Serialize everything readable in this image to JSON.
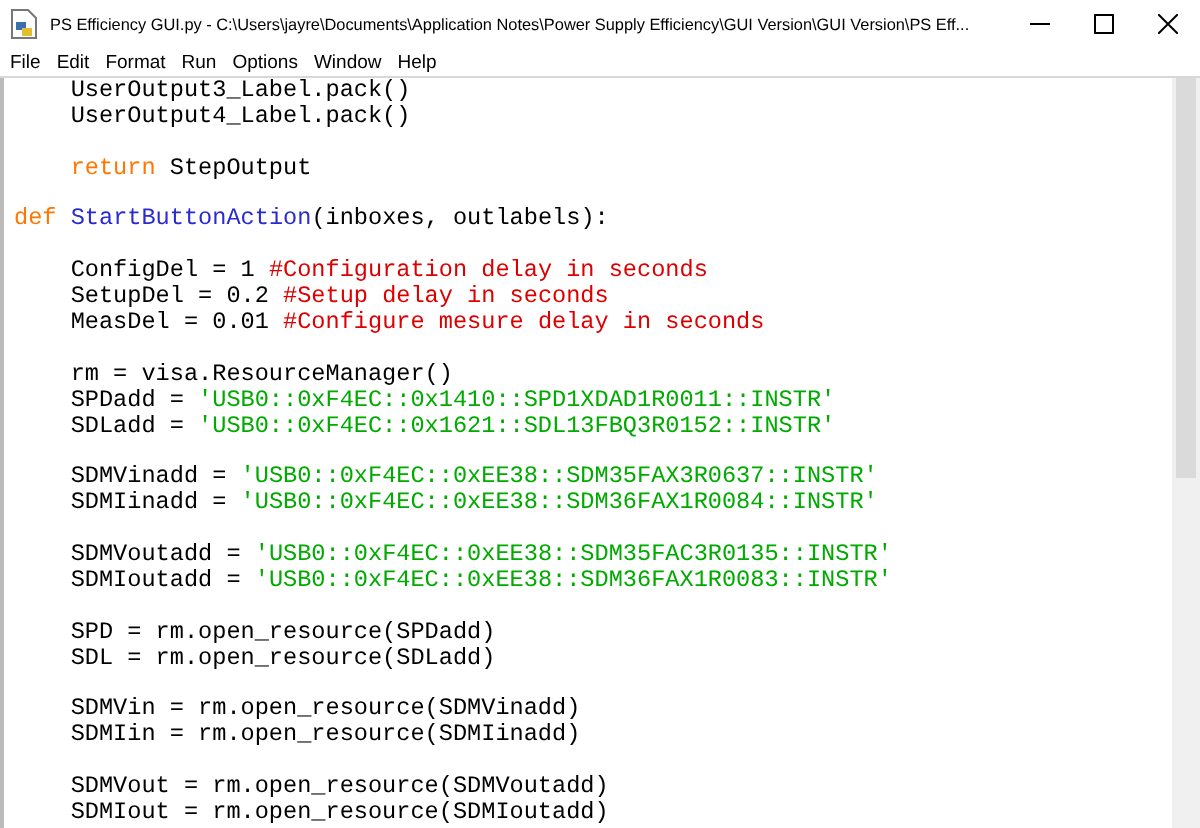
{
  "window": {
    "title": "PS Efficiency GUI.py - C:\\Users\\jayre\\Documents\\Application Notes\\Power Supply Efficiency\\GUI Version\\GUI Version\\PS Eff..."
  },
  "menu": [
    "File",
    "Edit",
    "Format",
    "Run",
    "Options",
    "Window",
    "Help"
  ],
  "code": [
    {
      "kind": "code",
      "tokens": [
        {
          "kind": "plain",
          "text": "    UserOutput3_Label.pack()"
        }
      ]
    },
    {
      "kind": "code",
      "tokens": [
        {
          "kind": "plain",
          "text": "    UserOutput4_Label.pack()"
        }
      ]
    },
    {
      "kind": "blank"
    },
    {
      "kind": "code",
      "tokens": [
        {
          "kind": "keyword",
          "text": "    return"
        },
        {
          "kind": "plain",
          "text": " StepOutput"
        }
      ]
    },
    {
      "kind": "blank"
    },
    {
      "kind": "code",
      "tokens": [
        {
          "kind": "keyword",
          "text": "def"
        },
        {
          "kind": "definition",
          "text": " StartButtonAction"
        },
        {
          "kind": "plain",
          "text": "(inboxes, outlabels):"
        }
      ]
    },
    {
      "kind": "blank"
    },
    {
      "kind": "code",
      "tokens": [
        {
          "kind": "plain",
          "text": "    ConfigDel = 1 "
        },
        {
          "kind": "comment",
          "text": "#Configuration delay in seconds"
        }
      ]
    },
    {
      "kind": "code",
      "tokens": [
        {
          "kind": "plain",
          "text": "    SetupDel = 0.2 "
        },
        {
          "kind": "comment",
          "text": "#Setup delay in seconds"
        }
      ]
    },
    {
      "kind": "code",
      "tokens": [
        {
          "kind": "plain",
          "text": "    MeasDel = 0.01 "
        },
        {
          "kind": "comment",
          "text": "#Configure mesure delay in seconds"
        }
      ]
    },
    {
      "kind": "blank"
    },
    {
      "kind": "code",
      "tokens": [
        {
          "kind": "plain",
          "text": "    rm = visa.ResourceManager()"
        }
      ]
    },
    {
      "kind": "code",
      "tokens": [
        {
          "kind": "plain",
          "text": "    SPDadd = "
        },
        {
          "kind": "string",
          "text": "'USB0::0xF4EC::0x1410::SPD1XDAD1R0011::INSTR'"
        }
      ]
    },
    {
      "kind": "code",
      "tokens": [
        {
          "kind": "plain",
          "text": "    SDLadd = "
        },
        {
          "kind": "string",
          "text": "'USB0::0xF4EC::0x1621::SDL13FBQ3R0152::INSTR'"
        }
      ]
    },
    {
      "kind": "blank"
    },
    {
      "kind": "code",
      "tokens": [
        {
          "kind": "plain",
          "text": "    SDMVinadd = "
        },
        {
          "kind": "string",
          "text": "'USB0::0xF4EC::0xEE38::SDM35FAX3R0637::INSTR'"
        }
      ]
    },
    {
      "kind": "code",
      "tokens": [
        {
          "kind": "plain",
          "text": "    SDMIinadd = "
        },
        {
          "kind": "string",
          "text": "'USB0::0xF4EC::0xEE38::SDM36FAX1R0084::INSTR'"
        }
      ]
    },
    {
      "kind": "blank"
    },
    {
      "kind": "code",
      "tokens": [
        {
          "kind": "plain",
          "text": "    SDMVoutadd = "
        },
        {
          "kind": "string",
          "text": "'USB0::0xF4EC::0xEE38::SDM35FAC3R0135::INSTR'"
        }
      ]
    },
    {
      "kind": "code",
      "tokens": [
        {
          "kind": "plain",
          "text": "    SDMIoutadd = "
        },
        {
          "kind": "string",
          "text": "'USB0::0xF4EC::0xEE38::SDM36FAX1R0083::INSTR'"
        }
      ]
    },
    {
      "kind": "blank"
    },
    {
      "kind": "code",
      "tokens": [
        {
          "kind": "plain",
          "text": "    SPD = rm.open_resource(SPDadd)"
        }
      ]
    },
    {
      "kind": "code",
      "tokens": [
        {
          "kind": "plain",
          "text": "    SDL = rm.open_resource(SDLadd)"
        }
      ]
    },
    {
      "kind": "blank"
    },
    {
      "kind": "code",
      "tokens": [
        {
          "kind": "plain",
          "text": "    SDMVin = rm.open_resource(SDMVinadd)"
        }
      ]
    },
    {
      "kind": "code",
      "tokens": [
        {
          "kind": "plain",
          "text": "    SDMIin = rm.open_resource(SDMIinadd)"
        }
      ]
    },
    {
      "kind": "blank"
    },
    {
      "kind": "code",
      "tokens": [
        {
          "kind": "plain",
          "text": "    SDMVout = rm.open_resource(SDMVoutadd)"
        }
      ]
    },
    {
      "kind": "code",
      "tokens": [
        {
          "kind": "plain",
          "text": "    SDMIout = rm.open_resource(SDMIoutadd)"
        }
      ]
    }
  ]
}
